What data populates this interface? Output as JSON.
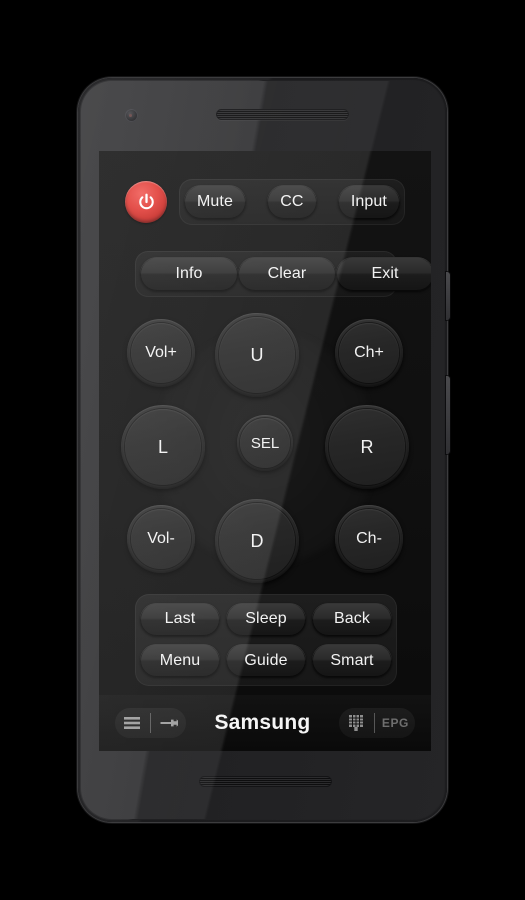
{
  "device": {
    "camera_icon": "camera-icon",
    "earpiece_icon": "earpiece-speaker-grille",
    "bottom_speaker_icon": "bottom-speaker-grille",
    "power_side_button": "power-side-button",
    "volume_side_button": "volume-side-button"
  },
  "app": {
    "power": {
      "label": "",
      "icon": "power-icon",
      "color": "#e03a34"
    },
    "row_top": [
      {
        "label": "Mute"
      },
      {
        "label": "CC"
      },
      {
        "label": "Input"
      }
    ],
    "row_second": [
      {
        "label": "Info"
      },
      {
        "label": "Clear"
      },
      {
        "label": "Exit"
      }
    ],
    "dpad": {
      "vol_up": "Vol+",
      "up": "U",
      "ch_up": "Ch+",
      "left": "L",
      "select": "SEL",
      "right": "R",
      "vol_down": "Vol-",
      "down": "D",
      "ch_down": "Ch-"
    },
    "panel": {
      "row1": [
        {
          "label": "Last"
        },
        {
          "label": "Sleep"
        },
        {
          "label": "Back"
        }
      ],
      "row2": [
        {
          "label": "Menu"
        },
        {
          "label": "Guide"
        },
        {
          "label": "Smart"
        }
      ]
    },
    "footer": {
      "menu_icon": "hamburger-menu-icon",
      "tools_icon": "wrench-icon",
      "title": "Samsung",
      "keypad_icon": "numeric-keypad-icon",
      "epg_label": "EPG"
    }
  }
}
